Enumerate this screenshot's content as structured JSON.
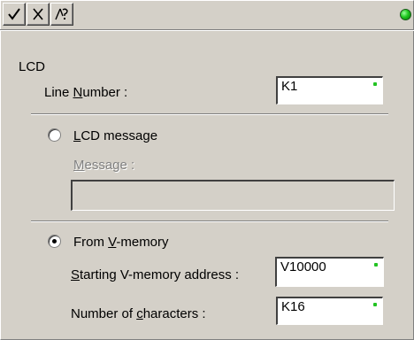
{
  "toolbar": {
    "buttons": [
      {
        "icon": "check-icon"
      },
      {
        "icon": "close-icon"
      },
      {
        "icon": "help-icon"
      }
    ]
  },
  "status": {
    "color": "#1ec81e"
  },
  "section": {
    "title": "LCD"
  },
  "line_number": {
    "label_pre": "Line ",
    "label_ul": "N",
    "label_post": "umber :",
    "value": "K1"
  },
  "lcd_message": {
    "selected": false,
    "label_pre": "",
    "label_ul": "L",
    "label_post": "CD message"
  },
  "message": {
    "label_pre": "",
    "label_ul": "M",
    "label_post": "essage :",
    "value": ""
  },
  "vmemory": {
    "selected": true,
    "label_pre": "From ",
    "label_ul": "V",
    "label_post": "-memory"
  },
  "start_address": {
    "label_pre": "",
    "label_ul": "S",
    "label_post": "tarting V-memory address :",
    "value": "V10000"
  },
  "num_chars": {
    "label_pre": "Number of ",
    "label_ul": "c",
    "label_post": "haracters :",
    "value": "K16"
  }
}
